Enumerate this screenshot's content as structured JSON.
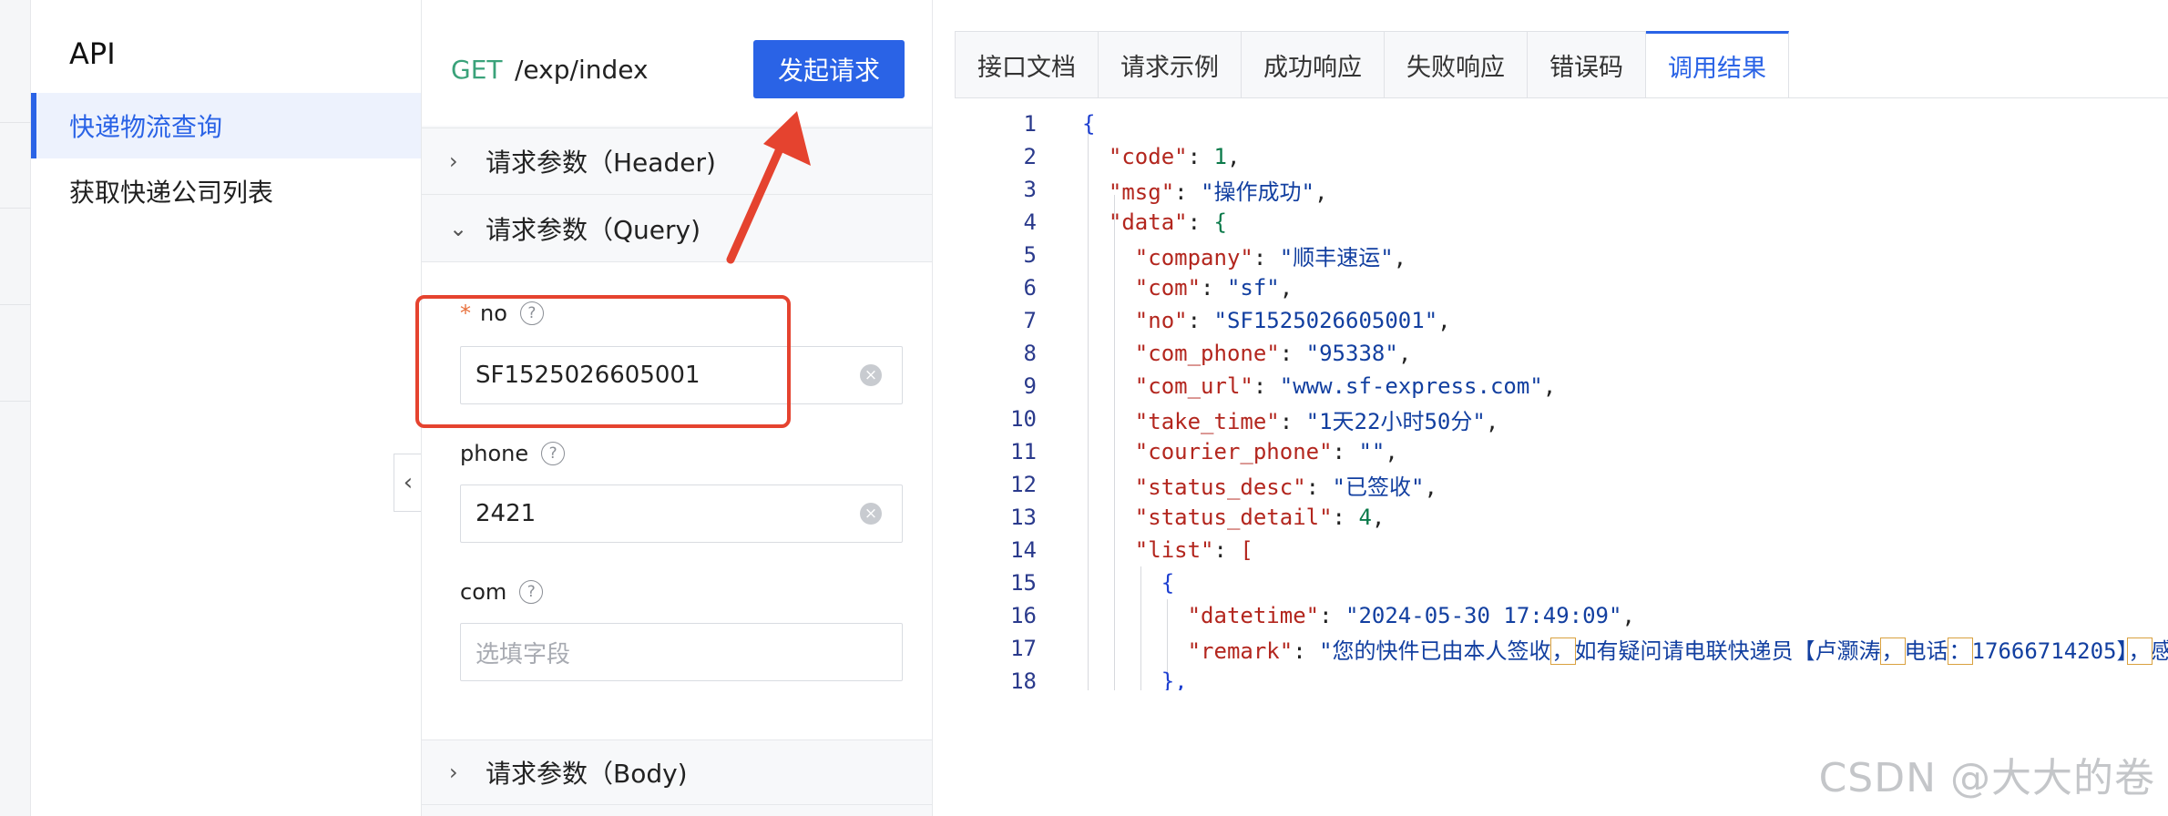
{
  "nav": {
    "title": "API",
    "items": [
      {
        "label": "快递物流查询",
        "active": true
      },
      {
        "label": "获取快递公司列表",
        "active": false
      }
    ]
  },
  "request": {
    "method": "GET",
    "path": "/exp/index",
    "send_label": "发起请求",
    "sections": {
      "header": "请求参数（Header)",
      "query": "请求参数（Query)",
      "body": "请求参数（Body)"
    },
    "fields": [
      {
        "name": "no",
        "required": true,
        "value": "SF1525026605001",
        "placeholder": ""
      },
      {
        "name": "phone",
        "required": false,
        "value": "2421",
        "placeholder": ""
      },
      {
        "name": "com",
        "required": false,
        "value": "",
        "placeholder": "选填字段"
      }
    ]
  },
  "result": {
    "tabs": [
      "接口文档",
      "请求示例",
      "成功响应",
      "失败响应",
      "错误码",
      "调用结果"
    ],
    "active_tab": "调用结果",
    "line_numbers": [
      "1",
      "2",
      "3",
      "4",
      "5",
      "6",
      "7",
      "8",
      "9",
      "10",
      "11",
      "12",
      "13",
      "14",
      "15",
      "16",
      "17",
      "18"
    ],
    "response": {
      "code": "1",
      "msg": "\"操作成功\"",
      "company": "\"顺丰速运\"",
      "com": "\"sf\"",
      "no": "\"SF1525026605001\"",
      "com_phone": "\"95338\"",
      "com_url": "\"www.sf-express.com\"",
      "take_time": "\"1天22小时50分\"",
      "courier_phone": "\"\"",
      "status_desc": "\"已签收\"",
      "status_detail": "4",
      "datetime": "\"2024-05-30 17:49:09\"",
      "remark_parts": [
        "\"您的快件已由本人签收",
        "，",
        "如有疑问请电联快递员【卢灏涛",
        "，",
        "电话",
        "：",
        "17666714205】",
        "，",
        "感谢"
      ]
    }
  },
  "watermark": "CSDN @大大的卷",
  "colors": {
    "accent": "#2a63e6",
    "method_get": "#3aa27a",
    "annotation_red": "#e5432f"
  },
  "icons": [
    "chevron-right-icon",
    "chevron-down-icon",
    "chevron-left-icon",
    "help-icon",
    "clear-icon",
    "arrow-annotation"
  ]
}
